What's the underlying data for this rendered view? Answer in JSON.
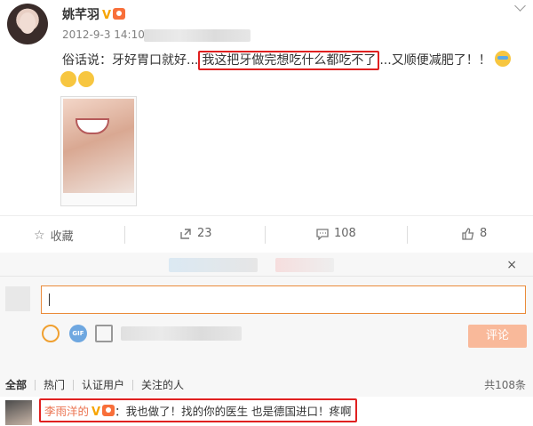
{
  "post": {
    "author": "姚芊羽",
    "verified_badge": "V",
    "timestamp": "2012-9-3 14:10",
    "text_before": "俗话说：牙好胃口就好...",
    "text_highlight": "我这把牙做完想吃什么都吃不了",
    "text_after": "...又顺便减肥了！！"
  },
  "actions": {
    "favorite_label": "收藏",
    "repost_count": "23",
    "comment_count": "108",
    "like_count": "8"
  },
  "comment_box": {
    "submit_label": "评论",
    "close_symbol": "×"
  },
  "comment_tabs": {
    "items": [
      "全部",
      "热门",
      "认证用户",
      "关注的人"
    ],
    "total": "共108条"
  },
  "comment": {
    "author": "李雨洋的",
    "text": "：我也做了！找的你的医生 也是德国进口！疼啊"
  },
  "colors": {
    "accent": "#eb7350",
    "highlight_border": "#e02020",
    "submit_bg": "#f9b99a"
  },
  "icons": [
    "star-icon",
    "repost-icon",
    "comment-icon",
    "like-icon",
    "smile-icon",
    "gif-icon",
    "image-icon",
    "chevron-down-icon",
    "close-icon"
  ]
}
